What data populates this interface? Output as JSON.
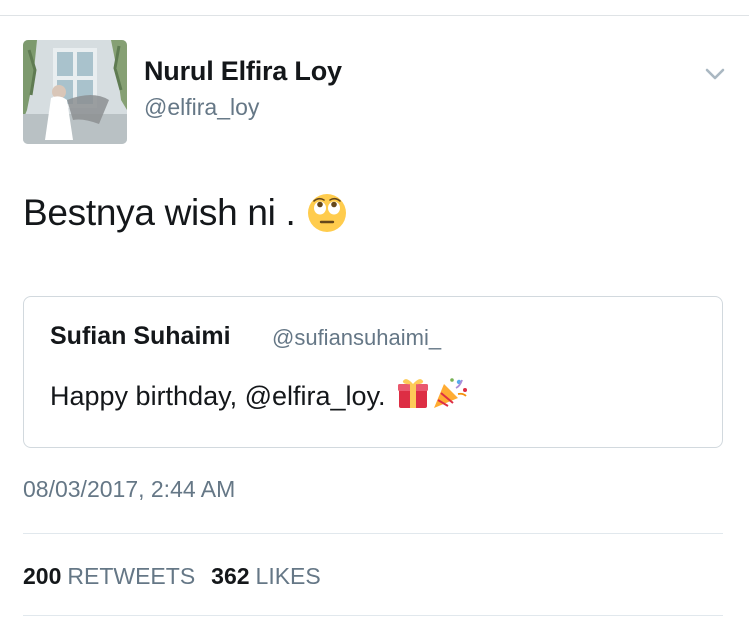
{
  "author": {
    "display_name": "Nurul Elfira Loy",
    "handle": "@elfira_loy",
    "avatar_icon": "profile-photo"
  },
  "tweet": {
    "text": "Bestnya wish ni .",
    "emoji": "face-with-rolling-eyes"
  },
  "quoted_tweet": {
    "display_name": "Sufian Suhaimi",
    "handle": "@sufiansuhaimi_",
    "text": "Happy birthday, @elfira_loy.",
    "emojis": [
      "wrapped-gift",
      "party-popper"
    ]
  },
  "timestamp": "08/03/2017, 2:44 AM",
  "stats": {
    "retweets_count": "200",
    "retweets_label": "RETWEETS",
    "likes_count": "362",
    "likes_label": "LIKES"
  },
  "colors": {
    "text_primary": "#14171a",
    "text_secondary": "#657786",
    "divider": "#e1e8ed"
  }
}
